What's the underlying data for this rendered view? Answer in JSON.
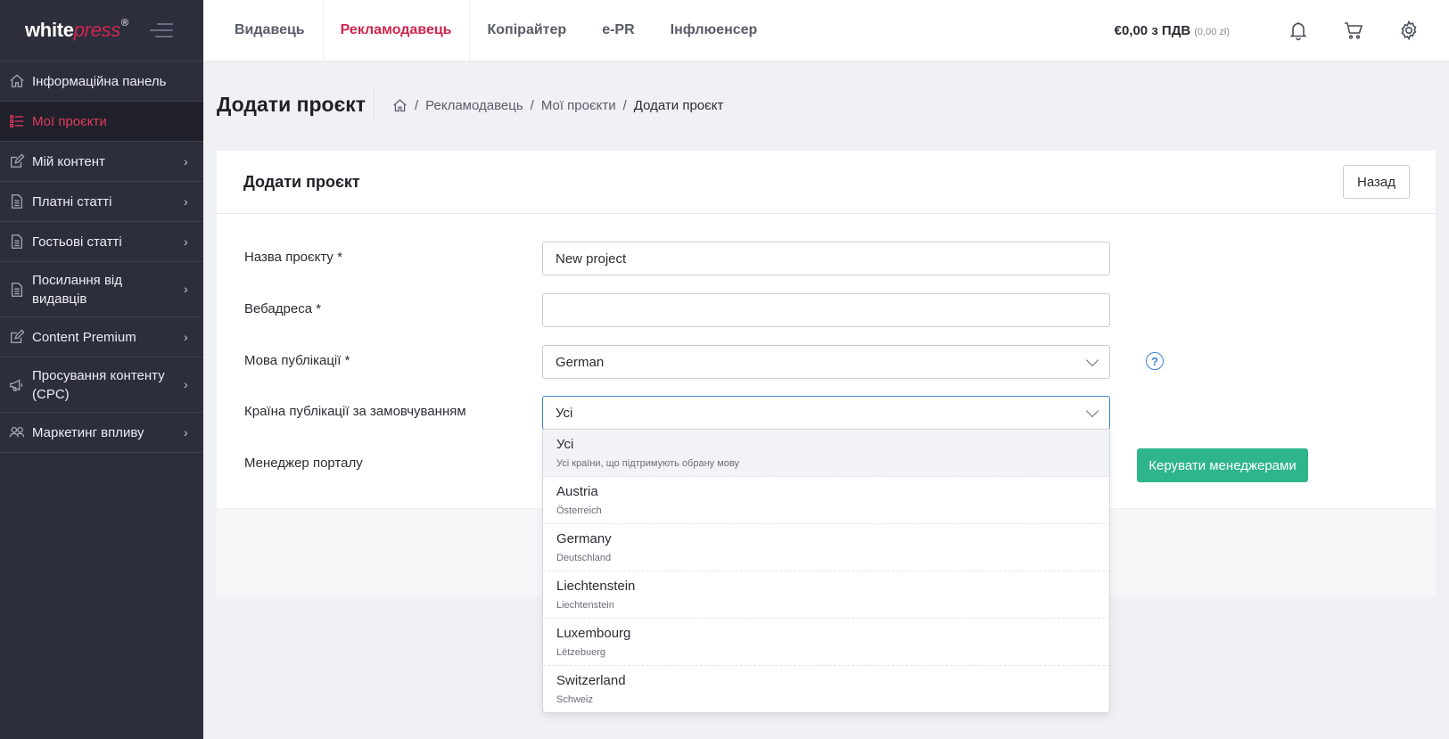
{
  "logo": {
    "white": "white",
    "press": "press",
    "reg": "®"
  },
  "sidebar": {
    "items": [
      {
        "label": "Інформаційна панель",
        "icon": "home-icon",
        "active": false,
        "chevron": false
      },
      {
        "label": "Мої проєкти",
        "icon": "list-icon",
        "active": true,
        "chevron": false
      },
      {
        "label": "Мій контент",
        "icon": "edit-icon",
        "active": false,
        "chevron": true
      },
      {
        "label": "Платні статті",
        "icon": "document-icon",
        "active": false,
        "chevron": true
      },
      {
        "label": "Гостьові статті",
        "icon": "document-icon",
        "active": false,
        "chevron": true
      },
      {
        "label": "Посилання від видавців",
        "icon": "document-icon",
        "active": false,
        "chevron": true
      },
      {
        "label": "Content Premium",
        "icon": "edit-icon",
        "active": false,
        "chevron": true
      },
      {
        "label": "Просування контенту (CPC)",
        "icon": "megaphone-icon",
        "active": false,
        "chevron": true
      },
      {
        "label": "Маркетинг впливу",
        "icon": "users-icon",
        "active": false,
        "chevron": true
      }
    ],
    "chevron": "›"
  },
  "topbar": {
    "tabs": [
      "Видавець",
      "Рекламодавець",
      "Копірайтер",
      "e-PR",
      "Інфлюенсер"
    ],
    "active_tab": 1,
    "balance": "€0,00 з ПДВ",
    "balance_sub": "(0,00 zł)"
  },
  "header": {
    "title": "Додати проєкт",
    "breadcrumb": [
      "Рекламодавець",
      "Мої проєкти"
    ],
    "breadcrumb_current": "Додати проєкт",
    "sep": "/"
  },
  "card": {
    "title": "Додати проєкт",
    "back": "Назад"
  },
  "form": {
    "project_name_label": "Назва проєкту *",
    "project_name_value": "New project",
    "url_label": "Вебадреса *",
    "url_value": "",
    "language_label": "Мова публікації *",
    "language_value": "German",
    "help": "?",
    "country_label": "Країна публікації за замовчуванням",
    "country_value": "Усі",
    "manager_label": "Менеджер порталу",
    "managers_button": "Керувати менеджерами"
  },
  "dropdown": {
    "options": [
      {
        "main": "Усі",
        "sub": "Усі країни, що підтримують обрану мову"
      },
      {
        "main": "Austria",
        "sub": "Österreich"
      },
      {
        "main": "Germany",
        "sub": "Deutschland"
      },
      {
        "main": "Liechtenstein",
        "sub": "Liechtenstein"
      },
      {
        "main": "Luxembourg",
        "sub": "Lëtzebuerg"
      },
      {
        "main": "Switzerland",
        "sub": "Schweiz"
      }
    ],
    "highlighted": 0
  },
  "colors": {
    "accent": "#d0264e",
    "sidebar": "#2c2e3c",
    "primary_button": "#2fb58c",
    "focus": "#3b82d6"
  }
}
